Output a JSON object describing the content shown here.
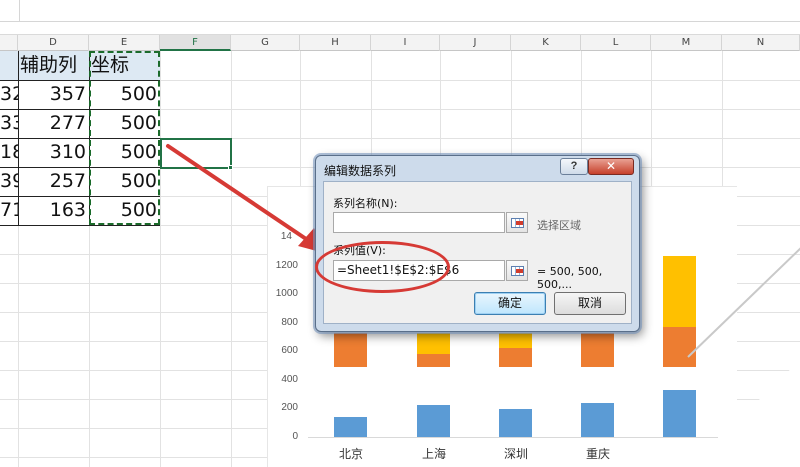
{
  "columns": [
    "D",
    "E",
    "F",
    "G",
    "H",
    "I",
    "J",
    "K",
    "L",
    "M",
    "N"
  ],
  "active_column": "F",
  "table": {
    "headers": [
      "辅助列",
      "坐标"
    ],
    "rows": [
      {
        "c": "32",
        "d": "357",
        "e": "500"
      },
      {
        "c": "33",
        "d": "277",
        "e": "500"
      },
      {
        "c": "18",
        "d": "310",
        "e": "500"
      },
      {
        "c": "39",
        "d": "257",
        "e": "500"
      },
      {
        "c": "71",
        "d": "163",
        "e": "500"
      }
    ]
  },
  "chart": {
    "y_ticks": [
      "0",
      "200",
      "400",
      "600",
      "800",
      "1000",
      "1200",
      "14"
    ],
    "categories": [
      "北京",
      "上海",
      "深圳",
      "重庆"
    ],
    "colors": {
      "blue": "#5b9bd5",
      "orange": "#ed7d31",
      "yellow": "#ffc000"
    }
  },
  "dialog": {
    "title": "编辑数据系列",
    "help_label": "?",
    "close_label": "✕",
    "name_label": "系列名称(N):",
    "name_value": "",
    "select_range_hint": "选择区域",
    "values_label": "系列值(V):",
    "values_value": "=Sheet1!$E$2:$E$6",
    "values_preview": "= 500, 500, 500,...",
    "ok_label": "确定",
    "cancel_label": "取消"
  },
  "annotation_color": "#d63a35"
}
